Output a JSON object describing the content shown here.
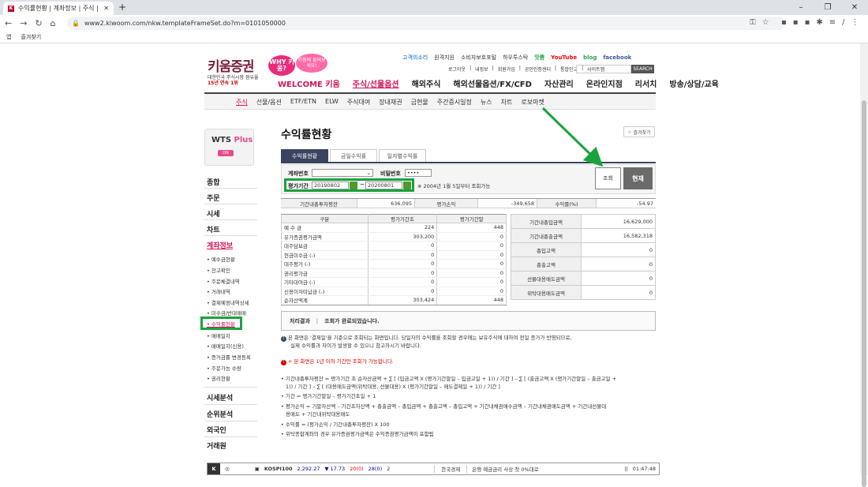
{
  "browser": {
    "tab_title": "수익률현황 | 계좌정보 | 주식 | 키움",
    "url": "www2.kiwoom.com/nkw.templateFrameSet.do?m=0101050000",
    "bookmarks": [
      "앱",
      "즐겨찾기"
    ]
  },
  "header": {
    "logo": "키움증권",
    "logo_sub1": "대한민국 주식시장 점유율",
    "logo_sub2": "15년 연속 1위",
    "bubble1": "WHY 키움?",
    "bubble2": "키움에 물어보세요!",
    "toplinks": [
      "고객의소리",
      "원격지원",
      "소비자보호포털",
      "하우투스탁",
      "맛쁨",
      "YouTube",
      "blog",
      "facebook"
    ],
    "toplinks2": [
      "로그아웃",
      "내정보",
      "회원가입",
      "공인인증센터",
      "통합인고",
      "사이트맵"
    ],
    "search_label": "SEARCH"
  },
  "mainnav": [
    "WELCOME 키움",
    "주식/선물옵션",
    "해외주식",
    "해외선물옵션/FX/CFD",
    "자산관리",
    "온라인지점",
    "리서치",
    "방송/상담/교육"
  ],
  "subnav": [
    "주식",
    "선물/옵션",
    "ETF/ETN",
    "ELW",
    "주식대여",
    "장내채권",
    "금현물",
    "주간증시일정",
    "뉴스",
    "차트",
    "로보마켓"
  ],
  "sidebar": {
    "wts": "WTS",
    "wts_plus": "Plus",
    "wts_chip": "ON",
    "main": [
      "종합",
      "주문",
      "시세",
      "차트",
      "계좌정보"
    ],
    "sub": [
      "예수금현황",
      "잔고확인",
      "주문체결내역",
      "거래내역",
      "결제예정내역상세",
      "미수금/반대매매",
      "수익률현황",
      "매매일지",
      "매매일지(신용)",
      "증거금률 변경등록",
      "주문가능 수량",
      "권리현황"
    ],
    "bottom": [
      "시세분석",
      "순위분석",
      "외국인",
      "거래원"
    ]
  },
  "page": {
    "title": "수익률현황",
    "favorite": "즐겨찾기",
    "tabs": [
      "수익률현황",
      "금일수익률",
      "일자별수익률"
    ]
  },
  "form": {
    "account_label": "계좌번호",
    "password_label": "비밀번호",
    "password_value": "••••",
    "period_label": "평가기간",
    "date_from": "20190802",
    "tilde": "~",
    "date_to": "20200801",
    "note": "※ 2004년 1월 5일부터 조회가능",
    "inquiry_button": "조회",
    "current_button": "현재"
  },
  "summary": {
    "l1": "기간내총투자평잔",
    "v1": "636,095",
    "l2": "평가손익",
    "v2": "-349,658",
    "l3": "수익률(%)",
    "v3": "-54.97"
  },
  "table_left": {
    "headers": [
      "구분",
      "평가기간초",
      "평가기간말"
    ],
    "rows": [
      [
        "예 수 금",
        "224",
        "448"
      ],
      [
        "유가증권평가금액",
        "303,200",
        "0"
      ],
      [
        "대주담보금",
        "0",
        "0"
      ],
      [
        "현금미수금 (-)",
        "0",
        "0"
      ],
      [
        "대주평가 (-)",
        "0",
        "0"
      ],
      [
        "권리평가금",
        "0",
        "0"
      ],
      [
        "기타대여금 (-)",
        "0",
        "0"
      ],
      [
        "신용이자미납금 (-)",
        "0",
        "0"
      ],
      [
        "순자산액계",
        "303,424",
        "448"
      ]
    ]
  },
  "table_right": {
    "rows": [
      [
        "기간내총입금액",
        "16,629,000"
      ],
      [
        "기간내총출금액",
        "16,582,318"
      ],
      [
        "총입고액",
        "0"
      ],
      [
        "총출고액",
        "0"
      ],
      [
        "선물대용매도금액",
        "0"
      ],
      [
        "위탁대용매도금액",
        "0"
      ]
    ]
  },
  "result": {
    "label": "처리결과",
    "sep": "|",
    "message": "조회가 완료되었습니다."
  },
  "info": {
    "i1": "본 화면은 '결제일'을 기준으로 조회되는 화면입니다. 당일자의 수익률을 조회할 경우에는 보유주식에 대하여 전일 종가가 반영되므로,",
    "i1b": "실제 수익률과 차이가 발생할 수 있으니 참고하시기 바랍니다.",
    "warn": "+ 본 화면은 1년 이하 기간만 조회가 가능합니다.",
    "f1": "• 기간내총투자평잔 = 평가기간 초 순자산금액 + ∑ [ (입금고액 X (평가기간말일 – 입금고일 + 1)) / 기간 ] – ∑ [ (출금고액 X (평가기간말일 – 출금고일 +",
    "f1b": "1)) / 기간 ] – ∑ [ (대용매도금액(위탁대용, 선물대용) X (평가기간말일 – 매도결제일 + 1)) / 기간 ]",
    "f2": "• 기간 = 평가기간말일 – 평가기간초일 + 1",
    "f3": "• 평가손익 = 기말자산액 – 기간초자산액 + 총출금액 – 총입금액 + 총출고액 – 총입고액 + 기간내채권매수금액 – 기간내채권매도금액 + 기간내선물대",
    "f3b": "용매도 + 기간내위탁대용매도",
    "f4": "• 수익률 = (평가손익 / 기간내총투자평잔) X 100",
    "f5": "• 위탁종합계좌의 경우 유가증권평가금액은 수익증권평가금액이 포함됨"
  },
  "ticker": {
    "index": "KOSPI100",
    "value": "2,292.27",
    "change": "▼ 17.73",
    "up": "20(0)",
    "down": "28(0)",
    "flat": "2",
    "news_source": "한국경제",
    "headline": "은행 예금금리 사상 첫 0%대로",
    "time": "01:47:48"
  },
  "colors": {
    "brand": "#d4145a",
    "highlight": "#1aa33c",
    "tab_active": "#3a4460"
  }
}
